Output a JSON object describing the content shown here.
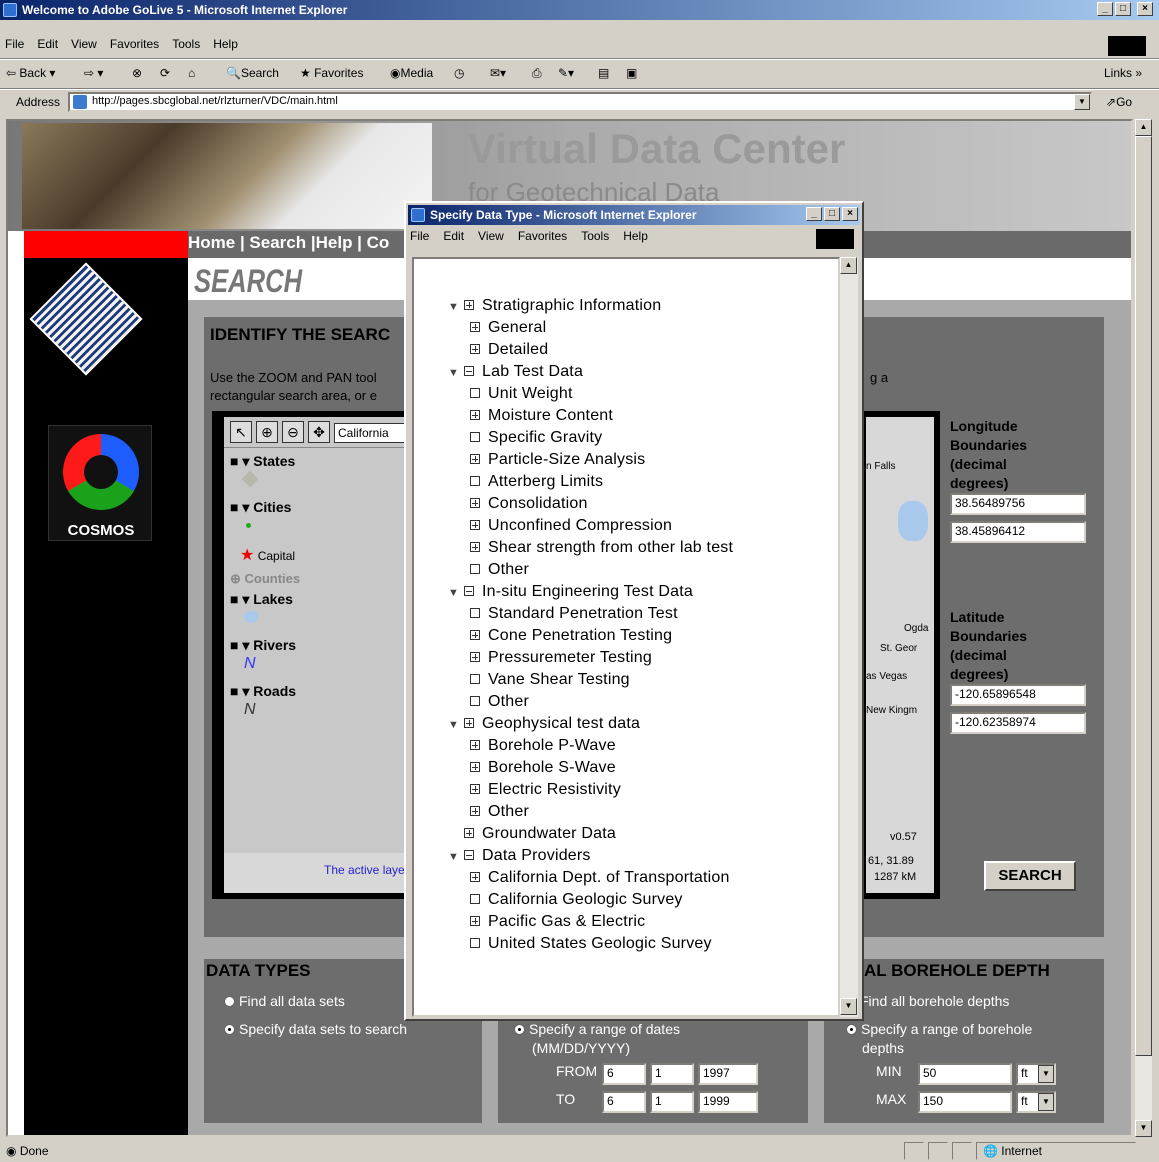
{
  "window": {
    "title": "Welcome to Adobe GoLive 5 - Microsoft Internet Explorer"
  },
  "menu": [
    "File",
    "Edit",
    "View",
    "Favorites",
    "Tools",
    "Help"
  ],
  "toolbar": {
    "back": "Back",
    "search": "Search",
    "favorites": "Favorites",
    "media": "Media",
    "links": "Links"
  },
  "address": {
    "label": "Address",
    "url": "http://pages.sbcglobal.net/rlzturner/VDC/main.html",
    "go": "Go"
  },
  "site": {
    "title": "Virtual Data Center",
    "subtitle": "for Geotechnical Data",
    "nav": "Home | Search |Help | Co",
    "search_heading": "SEARCH",
    "identify_heading": "IDENTIFY THE SEARC",
    "instructions": "Use the ZOOM and PAN tool",
    "instructions2": "rectangular search area, or e",
    "instructions_right": "g a",
    "cosmos": "COSMOS"
  },
  "map": {
    "state_select": "California",
    "layers": {
      "states": "States",
      "cities": "Cities",
      "capital": "Capital",
      "counties": "Counties",
      "lakes": "Lakes",
      "rivers": "Rivers",
      "roads": "Roads"
    },
    "active_layer": "The active laye",
    "places": [
      "n Falls",
      "Ogda",
      "St. Geor",
      "as Vegas",
      "New Kingm"
    ],
    "version": "v0.57",
    "coords": "61, 31.89",
    "scale": "1287 kM"
  },
  "longitude": {
    "label": "Longitude Boundaries (decimal degrees)",
    "val1": "38.56489756",
    "val2": "38.45896412"
  },
  "latitude": {
    "label": "Latitude Boundaries (decimal degrees)",
    "val1": "-120.65896548",
    "val2": "-120.62358974"
  },
  "search_button": "SEARCH",
  "data_types": {
    "heading": "DATA TYPES",
    "opt1": "Find all data sets",
    "opt2": "Specify data sets to search"
  },
  "dates": {
    "opt": "Specify a range of dates",
    "fmt": "(MM/DD/YYYY)",
    "from": "FROM",
    "to": "TO",
    "from_m": "6",
    "from_d": "1",
    "from_y": "1997",
    "to_m": "6",
    "to_d": "1",
    "to_y": "1999"
  },
  "depth": {
    "heading": "AL BOREHOLE DEPTH",
    "opt1": "Find all borehole depths",
    "opt2": "Specify a range of borehole",
    "opt2b": "depths",
    "min": "MIN",
    "max": "MAX",
    "min_val": "50",
    "max_val": "150",
    "unit": "ft"
  },
  "popup": {
    "title": "Specify Data Type - Microsoft Internet Explorer",
    "menu": [
      "File",
      "Edit",
      "View",
      "Favorites",
      "Tools",
      "Help"
    ],
    "tree": [
      {
        "t": "Stratigraphic Information",
        "lvl": 0,
        "tri": true,
        "box": "plus"
      },
      {
        "t": "General",
        "lvl": 1,
        "box": "plus"
      },
      {
        "t": "Detailed",
        "lvl": 1,
        "box": "plus"
      },
      {
        "t": "Lab Test Data",
        "lvl": 0,
        "tri": true,
        "box": "minus"
      },
      {
        "t": "Unit Weight",
        "lvl": 1,
        "box": "empty"
      },
      {
        "t": "Moisture Content",
        "lvl": 1,
        "box": "plus"
      },
      {
        "t": "Specific Gravity",
        "lvl": 1,
        "box": "empty"
      },
      {
        "t": "Particle-Size Analysis",
        "lvl": 1,
        "box": "plus"
      },
      {
        "t": "Atterberg Limits",
        "lvl": 1,
        "box": "empty"
      },
      {
        "t": "Consolidation",
        "lvl": 1,
        "box": "plus"
      },
      {
        "t": "Unconfined Compression",
        "lvl": 1,
        "box": "plus"
      },
      {
        "t": "Shear strength from other lab test",
        "lvl": 1,
        "box": "plus"
      },
      {
        "t": "Other",
        "lvl": 1,
        "box": "empty"
      },
      {
        "t": "In-situ Engineering Test Data",
        "lvl": 0,
        "tri": true,
        "box": "minus"
      },
      {
        "t": "Standard Penetration Test",
        "lvl": 1,
        "box": "empty"
      },
      {
        "t": "Cone Penetration Testing",
        "lvl": 1,
        "box": "plus"
      },
      {
        "t": "Pressuremeter Testing",
        "lvl": 1,
        "box": "plus"
      },
      {
        "t": "Vane Shear Testing",
        "lvl": 1,
        "box": "empty"
      },
      {
        "t": "Other",
        "lvl": 1,
        "box": "empty"
      },
      {
        "t": "Geophysical test data",
        "lvl": 0,
        "tri": true,
        "box": "plus"
      },
      {
        "t": "Borehole P-Wave",
        "lvl": 1,
        "box": "plus"
      },
      {
        "t": "Borehole S-Wave",
        "lvl": 1,
        "box": "plus"
      },
      {
        "t": "Electric Resistivity",
        "lvl": 1,
        "box": "plus"
      },
      {
        "t": "Other",
        "lvl": 1,
        "box": "plus"
      },
      {
        "t": "Groundwater Data",
        "lvl": 0,
        "tri": false,
        "box": "plus"
      },
      {
        "t": "Data Providers",
        "lvl": 0,
        "tri": true,
        "box": "minus"
      },
      {
        "t": "California Dept. of Transportation",
        "lvl": 1,
        "box": "plus"
      },
      {
        "t": "California Geologic Survey",
        "lvl": 1,
        "box": "empty"
      },
      {
        "t": "Pacific Gas & Electric",
        "lvl": 1,
        "box": "plus"
      },
      {
        "t": "United States Geologic Survey",
        "lvl": 1,
        "box": "empty"
      }
    ]
  },
  "statusbar": {
    "text": "Done",
    "zone": "Internet"
  }
}
